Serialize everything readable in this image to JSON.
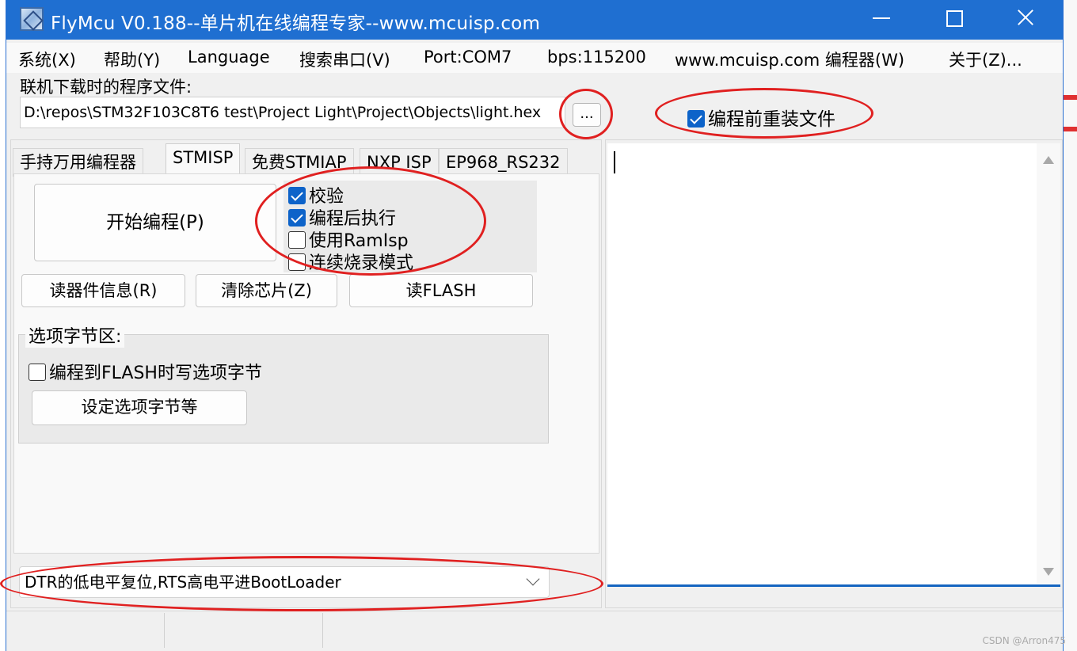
{
  "window": {
    "title": "FlyMcu V0.188--单片机在线编程专家--www.mcuisp.com"
  },
  "menubar": {
    "items": [
      "系统(X)",
      "帮助(Y)",
      "Language",
      "搜索串口(V)",
      "Port:COM7",
      "bps:115200",
      "www.mcuisp.com 编程器(W)",
      "关于(Z)..."
    ]
  },
  "file": {
    "label": "联机下载时的程序文件:",
    "path": "D:\\repos\\STM32F103C8T6 test\\Project Light\\Project\\Objects\\light.hex",
    "browse_label": "...",
    "reload_label": "编程前重装文件",
    "reload_checked": true
  },
  "tabs": [
    "手持万用编程器",
    "STMISP",
    "免费STMIAP",
    "NXP ISP",
    "EP968_RS232"
  ],
  "stmisp": {
    "start_button": "开始编程(P)",
    "options": [
      {
        "label": "校验",
        "checked": true
      },
      {
        "label": "编程后执行",
        "checked": true
      },
      {
        "label": "使用RamIsp",
        "checked": false
      },
      {
        "label": "连续烧录模式",
        "checked": false
      }
    ],
    "read_info_button": "读器件信息(R)",
    "erase_button": "清除芯片(Z)",
    "read_flash_button": "读FLASH",
    "option_bytes": {
      "legend": "选项字节区:",
      "write_label": "编程到FLASH时写选项字节",
      "write_checked": false,
      "set_button": "设定选项字节等"
    }
  },
  "reset_mode": {
    "selected": "DTR的低电平复位,RTS高电平进BootLoader"
  },
  "watermark": "CSDN @Arron475"
}
